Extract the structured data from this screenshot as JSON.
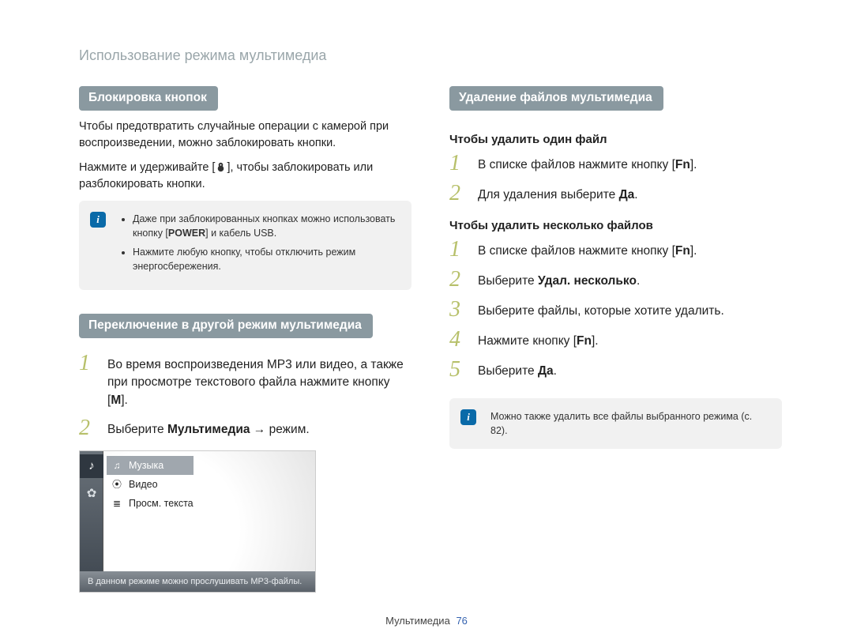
{
  "top_title": "Использование режима мультимедиа",
  "left": {
    "lock_header": "Блокировка кнопок",
    "lock_para1": "Чтобы предотвратить случайные операции с камерой при воспроизведении, можно заблокировать кнопки.",
    "lock_para2_before": "Нажмите и удерживайте [",
    "lock_para2_after": "], чтобы заблокировать или разблокировать кнопки.",
    "note1_li1_before": "Даже при заблокированных кнопках можно использовать кнопку [",
    "note1_power": "POWER",
    "note1_li1_after": "] и кабель USB.",
    "note1_li2": "Нажмите любую кнопку, чтобы отключить режим энергосбережения.",
    "switch_header": "Переключение в другой режим мультимедиа",
    "switch_step1_before": "Во время воспроизведения MP3 или видео, а также при просмотре текстового файла нажмите кнопку [",
    "switch_step1_key": "M",
    "switch_step1_after": "].",
    "switch_step2_before": "Выберите ",
    "switch_step2_bold": "Мультимедиа",
    "switch_step2_after": " → режим.",
    "menu_items": {
      "music": "Музыка",
      "video": "Видео",
      "text": "Просм. текста"
    },
    "menu_caption": "В данном режиме можно прослушивать MP3-файлы."
  },
  "right": {
    "del_header": "Удаление файлов мультимедиа",
    "sub1": "Чтобы удалить один файл",
    "one_step1_before": "В списке файлов нажмите кнопку [",
    "one_step1_key": "Fn",
    "one_step1_after": "].",
    "one_step2_before": "Для удаления выберите ",
    "one_step2_bold": "Да",
    "one_step2_after": ".",
    "sub2": "Чтобы удалить несколько файлов",
    "m_step1_before": "В списке файлов нажмите кнопку [",
    "m_step1_key": "Fn",
    "m_step1_after": "].",
    "m_step2_before": "Выберите ",
    "m_step2_bold": "Удал. несколько",
    "m_step2_after": ".",
    "m_step3": "Выберите файлы, которые хотите удалить.",
    "m_step4_before": "Нажмите кнопку [",
    "m_step4_key": "Fn",
    "m_step4_after": "].",
    "m_step5_before": "Выберите ",
    "m_step5_bold": "Да",
    "m_step5_after": ".",
    "note2": "Можно также удалить все файлы выбранного режима (с. 82)."
  },
  "footer_label": "Мультимедиа",
  "footer_page": "76"
}
